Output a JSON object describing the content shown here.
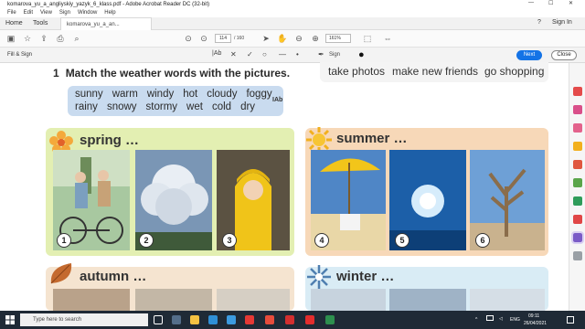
{
  "window": {
    "title": "komarova_yu_a_angliyskiy_yazyk_6_klass.pdf - Adobe Acrobat Reader DC (32-bit)",
    "controls": [
      "—",
      "☐",
      "✕"
    ]
  },
  "menu": [
    "File",
    "Edit",
    "View",
    "Sign",
    "Window",
    "Help"
  ],
  "tabs": {
    "home": "Home",
    "tools": "Tools",
    "document": "komarova_yu_a_an...",
    "help": "?",
    "sign_in": "Sign In"
  },
  "toolbar": {
    "page_current": "114",
    "page_total": "/ 160",
    "zoom": "161%"
  },
  "fill_sign": {
    "label": "Fill & Sign",
    "sign_label": "Sign",
    "next": "Next",
    "close": "Close"
  },
  "page": {
    "task_number": "1",
    "task_title": "Match the weather words with the pictures.",
    "activities": [
      "take photos",
      "make new friends",
      "go shopping"
    ],
    "words_row1": [
      "sunny",
      "warm",
      "windy",
      "hot",
      "cloudy",
      "foggy"
    ],
    "words_row2": [
      "rainy",
      "snowy",
      "stormy",
      "wet",
      "cold",
      "dry"
    ],
    "cursor_label": "IAb",
    "seasons": {
      "spring": "spring …",
      "summer": "summer …",
      "autumn": "autumn …",
      "winter": "winter …"
    },
    "photo_numbers": [
      "1",
      "2",
      "3",
      "4",
      "5",
      "6"
    ]
  },
  "taskbar": {
    "search_placeholder": "Type here to search",
    "time": "09:11",
    "date": "26/04/2021",
    "lang": "ENG"
  }
}
